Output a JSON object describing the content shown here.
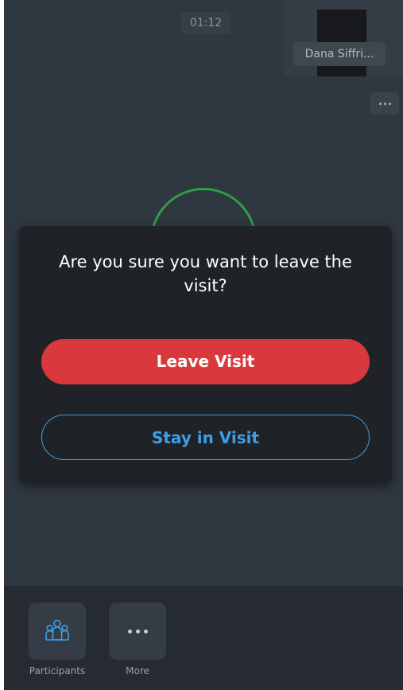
{
  "call": {
    "timer": "01:12",
    "self_view_name": "Dana Siffri..."
  },
  "dialog": {
    "message": "Are you sure you want to leave the visit?",
    "leave_label": "Leave Visit",
    "stay_label": "Stay in Visit"
  },
  "toolbar": {
    "participants_label": "Participants",
    "more_label": "More"
  },
  "icons": {
    "participants": "participants-icon",
    "more": "more-dots-icon",
    "tile_more": "ellipsis-icon"
  },
  "colors": {
    "leave_button": "#d9383c",
    "stay_button_outline": "#3d9fe8",
    "avatar_ring": "#2f9e44"
  }
}
